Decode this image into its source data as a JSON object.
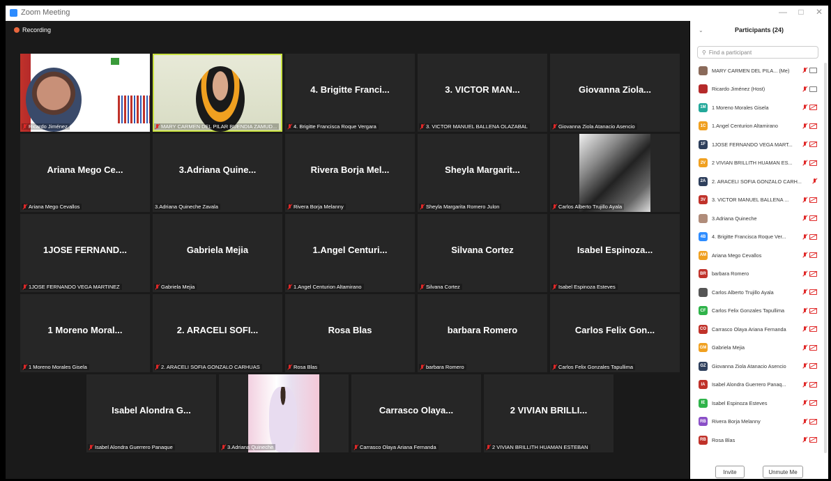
{
  "window": {
    "title": "Zoom Meeting",
    "minimize": "—",
    "maximize": "□",
    "close": "✕"
  },
  "recording": {
    "label": "Recording"
  },
  "tiles": [
    {
      "big": "",
      "label": "Ricardo Jiménez"
    },
    {
      "big": "",
      "label": "MARY CARMEN DEL PILAR BUENDIA ZAMUD..."
    },
    {
      "big": "4. Brigitte Franci...",
      "label": "4. Brigitte Francisca Roque Vergara"
    },
    {
      "big": "3. VICTOR MAN...",
      "label": "3. VICTOR MANUEL BALLENA OLAZABAL"
    },
    {
      "big": "Giovanna Ziola...",
      "label": "Giovanna Ziola Atanacio Asencio"
    },
    {
      "big": "Ariana Mego Ce...",
      "label": "Ariana Mego Cevallos"
    },
    {
      "big": "3.Adriana Quine...",
      "label": "3.Adriana Quineche Zavala"
    },
    {
      "big": "Rivera Borja Mel...",
      "label": "Rivera Borja Melanny"
    },
    {
      "big": "Sheyla Margarit...",
      "label": "Sheyla Margarita Romero Julon"
    },
    {
      "big": "",
      "label": "Carlos Alberto Trujillo Ayala"
    },
    {
      "big": "1JOSE FERNAND...",
      "label": "1JOSE FERNANDO VEGA MARTINEZ"
    },
    {
      "big": "Gabriela Mejia",
      "label": "Gabriela Mejia"
    },
    {
      "big": "1.Angel Centuri...",
      "label": "1.Angel Centurion Altamirano"
    },
    {
      "big": "Silvana Cortez",
      "label": "Silvana Cortez"
    },
    {
      "big": "Isabel Espinoza...",
      "label": "Isabel Espinoza Esteves"
    },
    {
      "big": "1 Moreno Moral...",
      "label": "1 Moreno Morales Gisela"
    },
    {
      "big": "2. ARACELI SOFI...",
      "label": "2. ARACELI SOFIA GONZALO CARHUAS"
    },
    {
      "big": "Rosa Blas",
      "label": "Rosa Blas"
    },
    {
      "big": "barbara Romero",
      "label": "barbara Romero"
    },
    {
      "big": "Carlos Felix Gon...",
      "label": "Carlos Felix Gonzales Tapullima"
    },
    {
      "big": "Isabel Alondra G...",
      "label": "Isabel Alondra Guerrero Panaque"
    },
    {
      "big": "",
      "label": "3.Adriana Quineche"
    },
    {
      "big": "Carrasco Olaya...",
      "label": "Carrasco Olaya Ariana Fernanda"
    },
    {
      "big": "2 VIVIAN BRILLI...",
      "label": "2 VIVIAN BRILLITH HUAMAN ESTEBAN"
    }
  ],
  "panel": {
    "title": "Participants (24)",
    "search_placeholder": "Find a participant",
    "invite": "Invite",
    "unmute": "Unmute Me",
    "participants": [
      {
        "initials": "",
        "color": "#8a6a5a",
        "name": "MARY CARMEN DEL PILA... (Me)",
        "cam": "on"
      },
      {
        "initials": "",
        "color": "#b52a2a",
        "name": "Ricardo Jiménez (Host)",
        "cam": "on"
      },
      {
        "initials": "1M",
        "color": "#23a89a",
        "name": "1 Moreno Morales Gisela",
        "cam": "off"
      },
      {
        "initials": "1C",
        "color": "#f0a020",
        "name": "1.Angel Centurion Altamirano",
        "cam": "off"
      },
      {
        "initials": "1F",
        "color": "#2e3f5c",
        "name": "1JOSE FERNANDO VEGA MART...",
        "cam": "off"
      },
      {
        "initials": "2V",
        "color": "#f0a020",
        "name": "2 VIVIAN BRILLITH HUAMAN ES...",
        "cam": "off"
      },
      {
        "initials": "2A",
        "color": "#2e3f5c",
        "name": "2. ARACELI SOFIA GONZALO CARH...",
        "cam": "none"
      },
      {
        "initials": "3V",
        "color": "#c0322a",
        "name": "3. VICTOR MANUEL BALLENA ...",
        "cam": "off"
      },
      {
        "initials": "",
        "color": "#b08c7a",
        "name": "3.Adriana Quineche",
        "cam": "off"
      },
      {
        "initials": "4B",
        "color": "#2d8cff",
        "name": "4. Brigitte Francisca Roque Ver...",
        "cam": "off"
      },
      {
        "initials": "AM",
        "color": "#f0a020",
        "name": "Ariana Mego Cevallos",
        "cam": "off"
      },
      {
        "initials": "BR",
        "color": "#c0322a",
        "name": "barbara Romero",
        "cam": "off"
      },
      {
        "initials": "",
        "color": "#555555",
        "name": "Carlos Alberto Trujillo Ayala",
        "cam": "off"
      },
      {
        "initials": "CF",
        "color": "#2fb34a",
        "name": "Carlos Felix Gonzales Tapullima",
        "cam": "off"
      },
      {
        "initials": "CO",
        "color": "#c0322a",
        "name": "Carrasco Olaya Ariana Fernanda",
        "cam": "off"
      },
      {
        "initials": "GM",
        "color": "#f0a020",
        "name": "Gabriela Mejia",
        "cam": "off"
      },
      {
        "initials": "GZ",
        "color": "#2e3f5c",
        "name": "Giovanna Ziola Atanacio Asencio",
        "cam": "off"
      },
      {
        "initials": "IA",
        "color": "#c0322a",
        "name": "Isabel Alondra Guerrero Panaq...",
        "cam": "off"
      },
      {
        "initials": "IE",
        "color": "#2fb34a",
        "name": "Isabel Espinoza Esteves",
        "cam": "off"
      },
      {
        "initials": "RB",
        "color": "#8a4fc7",
        "name": "Rivera Borja Melanny",
        "cam": "off"
      },
      {
        "initials": "RB",
        "color": "#c0322a",
        "name": "Rosa Blas",
        "cam": "off"
      }
    ]
  }
}
